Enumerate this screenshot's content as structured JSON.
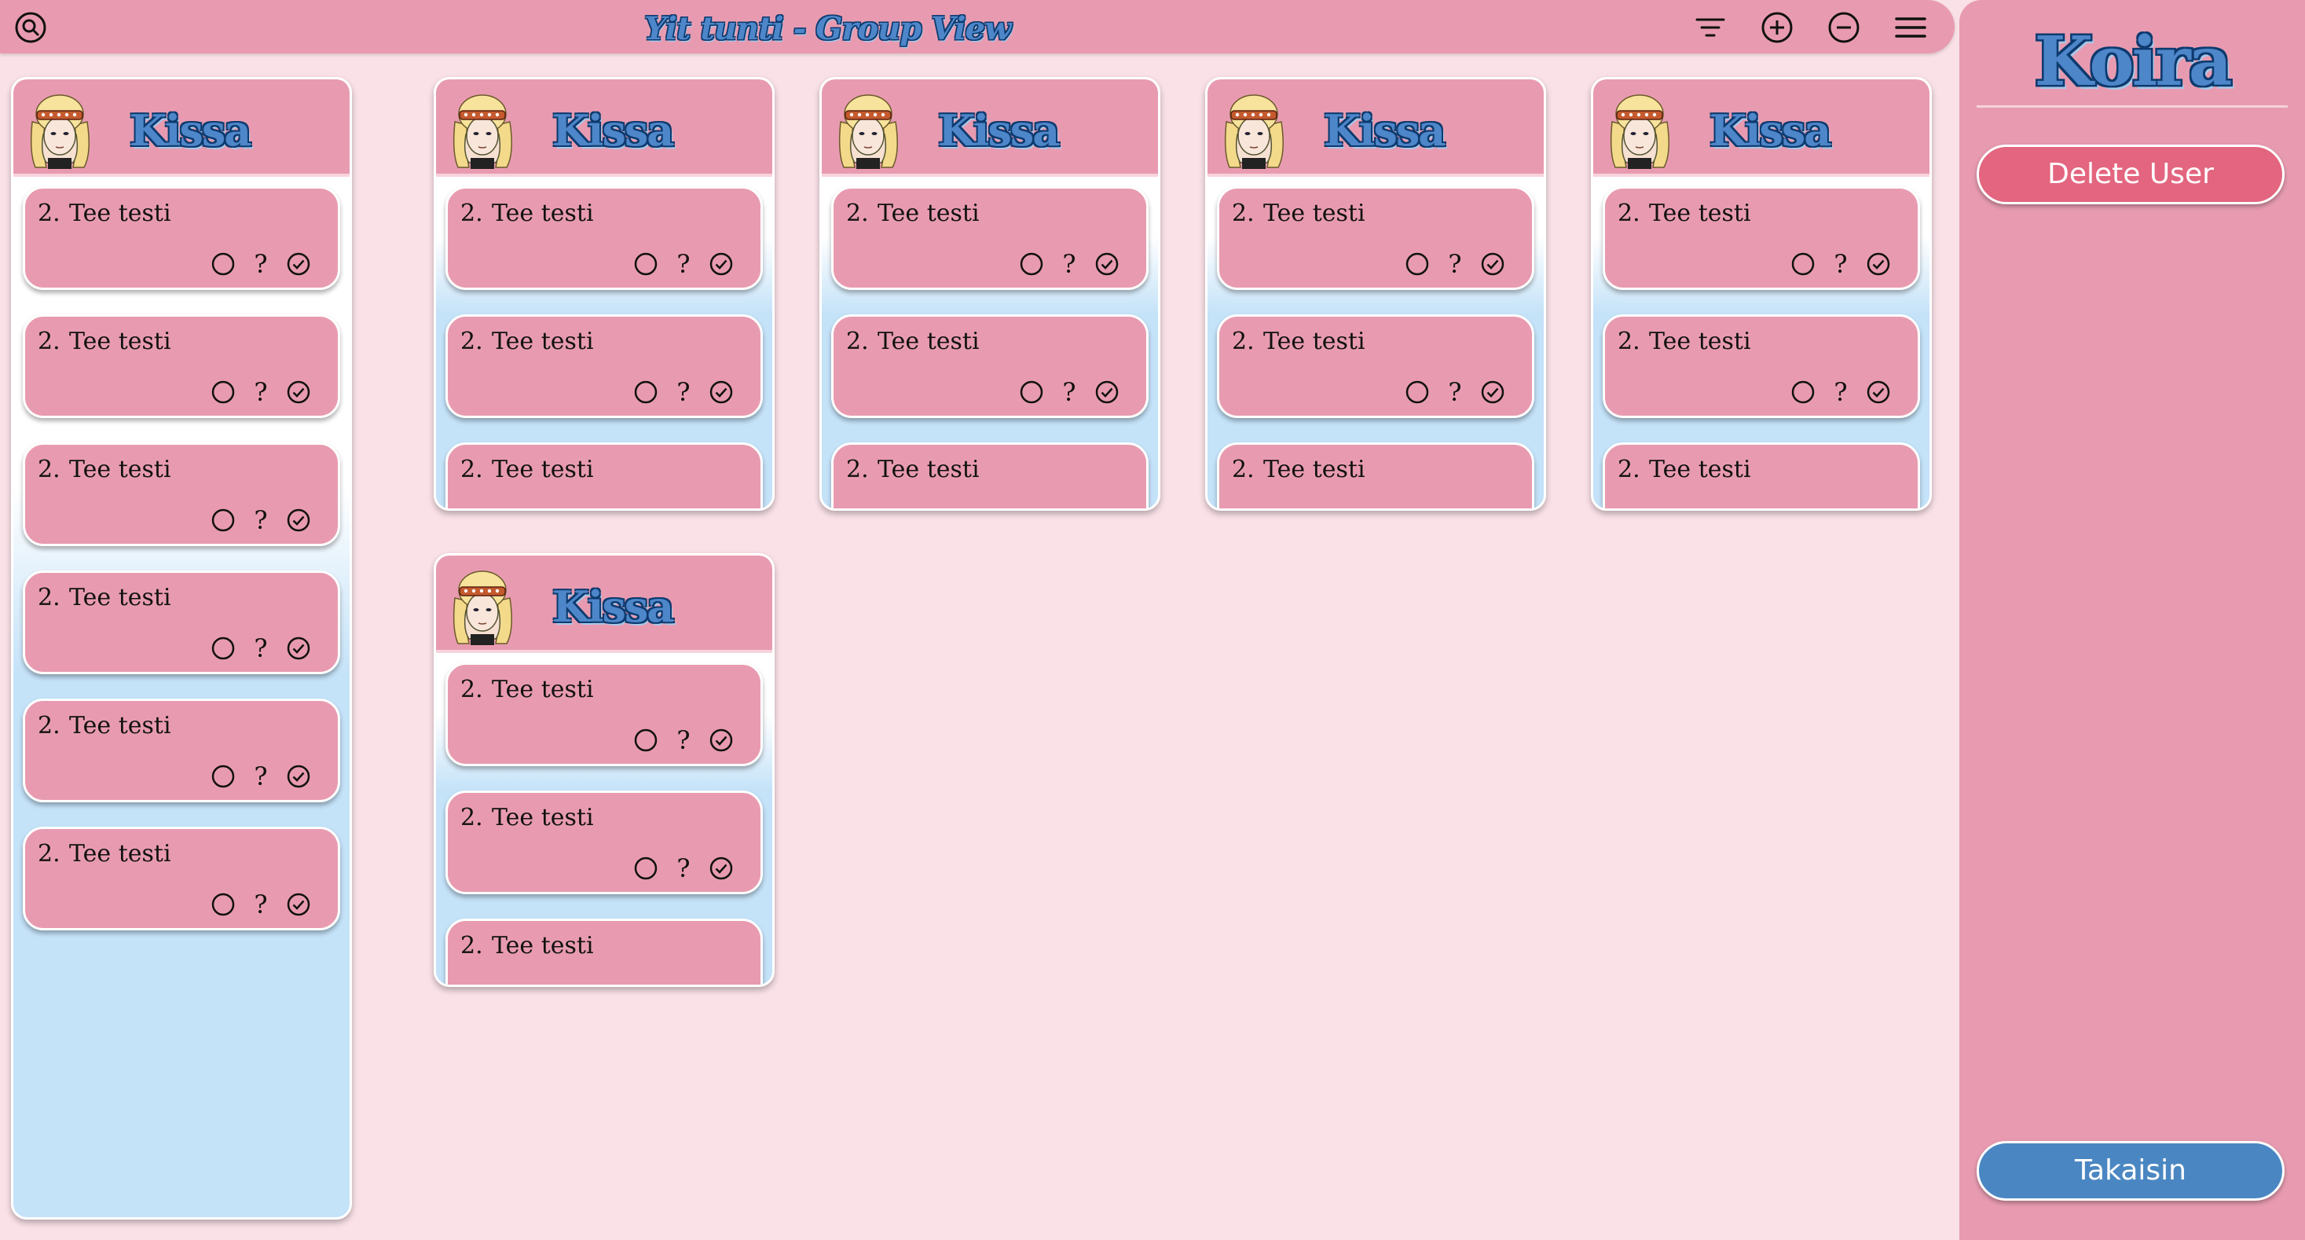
{
  "header": {
    "title": "Yit tunti - Group View",
    "icons": [
      "search-icon",
      "filter-icon",
      "zoom-in-icon",
      "zoom-out-icon",
      "menu-icon"
    ]
  },
  "columns": [
    {
      "name": "Kissa",
      "tasks": [
        {
          "num": "2.",
          "text": "Tee testi",
          "q": "?"
        },
        {
          "num": "2.",
          "text": "Tee testi",
          "q": "?"
        },
        {
          "num": "2.",
          "text": "Tee testi",
          "q": "?"
        },
        {
          "num": "2.",
          "text": "Tee testi",
          "q": "?"
        },
        {
          "num": "2.",
          "text": "Tee testi",
          "q": "?"
        },
        {
          "num": "2.",
          "text": "Tee testi",
          "q": "?"
        }
      ]
    },
    {
      "name": "Kissa",
      "tasks": [
        {
          "num": "2.",
          "text": "Tee testi",
          "q": "?"
        },
        {
          "num": "2.",
          "text": "Tee testi",
          "q": "?"
        },
        {
          "num": "2.",
          "text": "Tee testi",
          "q": "?"
        }
      ]
    },
    {
      "name": "Kissa",
      "tasks": [
        {
          "num": "2.",
          "text": "Tee testi",
          "q": "?"
        },
        {
          "num": "2.",
          "text": "Tee testi",
          "q": "?"
        },
        {
          "num": "2.",
          "text": "Tee testi",
          "q": "?"
        }
      ]
    },
    {
      "name": "Kissa",
      "tasks": [
        {
          "num": "2.",
          "text": "Tee testi",
          "q": "?"
        },
        {
          "num": "2.",
          "text": "Tee testi",
          "q": "?"
        },
        {
          "num": "2.",
          "text": "Tee testi",
          "q": "?"
        }
      ]
    },
    {
      "name": "Kissa",
      "tasks": [
        {
          "num": "2.",
          "text": "Tee testi",
          "q": "?"
        },
        {
          "num": "2.",
          "text": "Tee testi",
          "q": "?"
        },
        {
          "num": "2.",
          "text": "Tee testi",
          "q": "?"
        }
      ]
    },
    {
      "name": "Kissa",
      "tasks": [
        {
          "num": "2.",
          "text": "Tee testi",
          "q": "?"
        },
        {
          "num": "2.",
          "text": "Tee testi",
          "q": "?"
        },
        {
          "num": "2.",
          "text": "Tee testi",
          "q": "?"
        }
      ]
    }
  ],
  "sidebar": {
    "title": "Koira",
    "delete_label": "Delete User",
    "back_label": "Takaisin"
  },
  "colors": {
    "pink": "#e89bb0",
    "background": "#f9e1e7",
    "title_blue": "#4d86c9",
    "delete_red": "#e3657f",
    "back_blue": "#4a87c2",
    "lower_blue": "#c4e2f8"
  }
}
